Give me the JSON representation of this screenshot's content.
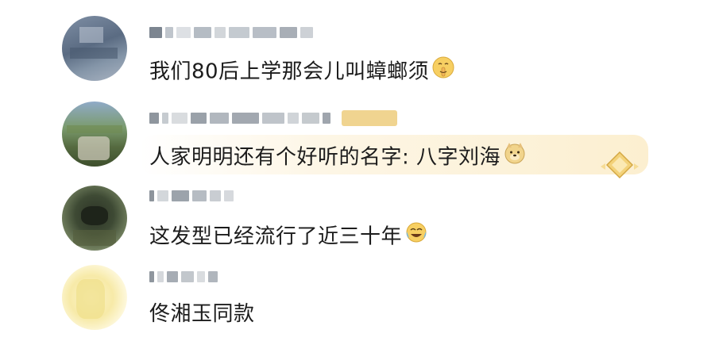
{
  "comments": [
    {
      "text": "我们80后上学那会儿叫蟑螂须",
      "emoji_name": "shh-face-emoji"
    },
    {
      "text": "人家明明还有个好听的名字: 八字刘海",
      "emoji_name": "doge-face-emoji",
      "badge_name": "gold-badge-icon"
    },
    {
      "text": "这发型已经流行了近三十年",
      "emoji_name": "laugh-cry-emoji"
    },
    {
      "text": "佟湘玉同款"
    }
  ],
  "colors": {
    "text": "#1c1c1c",
    "username_blur": "#cfd3d8",
    "badge_gold": "#e8c25a",
    "highlight_bg": "#fdf6e6"
  }
}
